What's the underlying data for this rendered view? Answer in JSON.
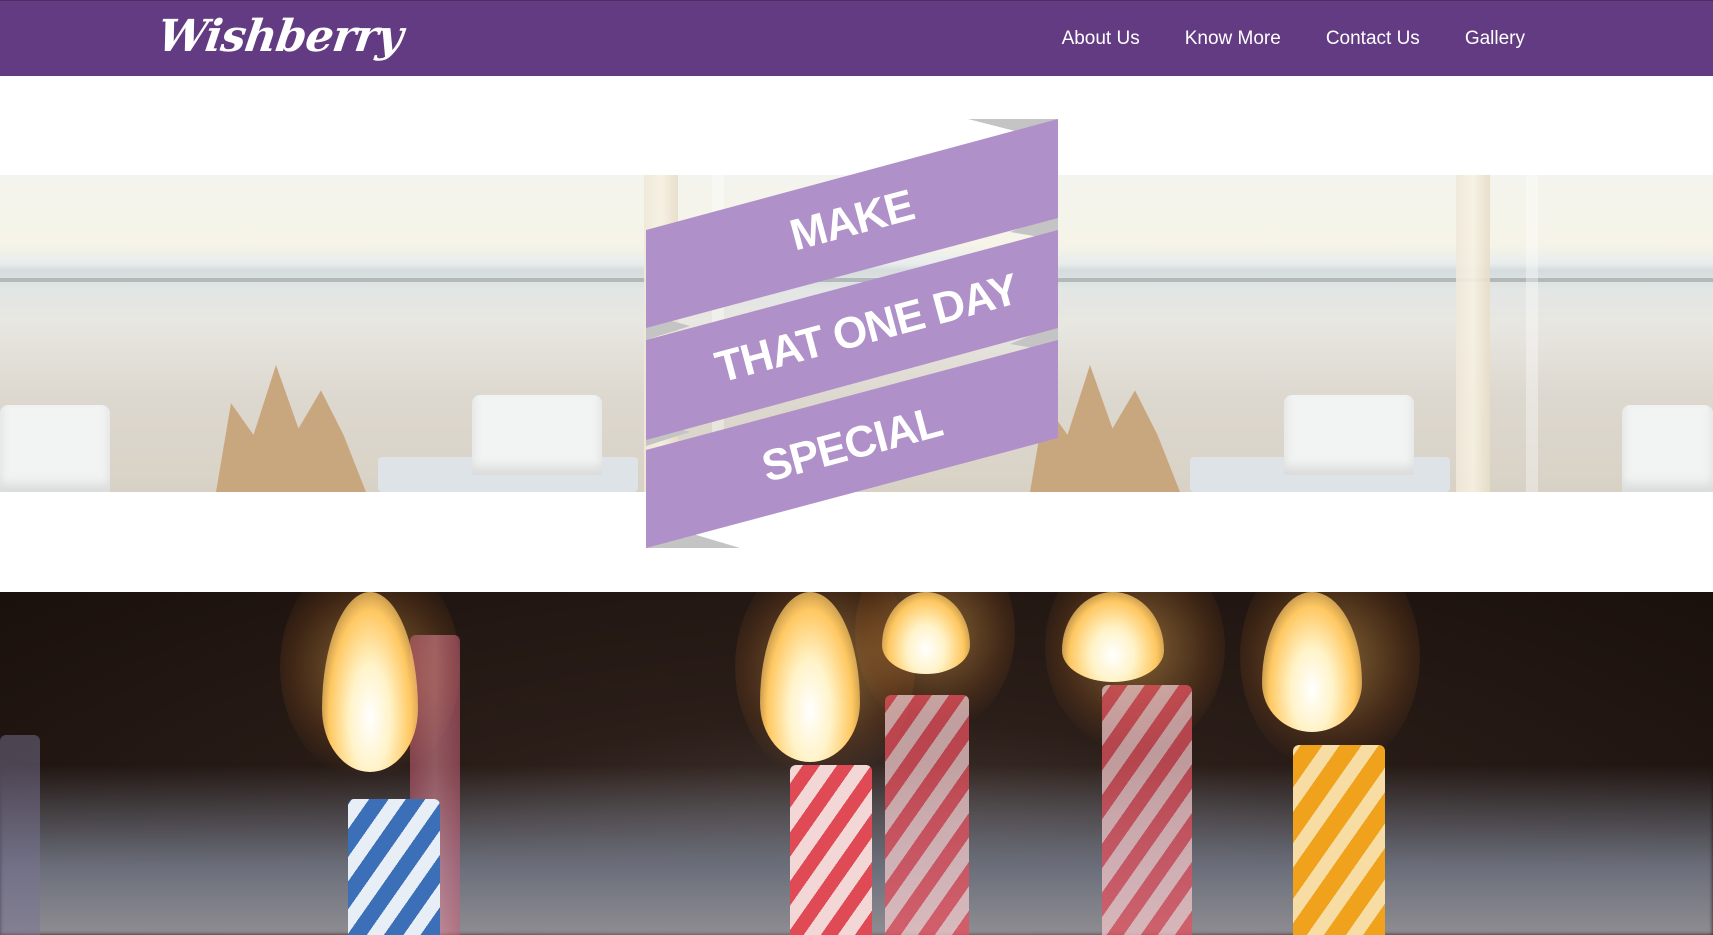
{
  "nav": {
    "brand": "Wishberry",
    "links": [
      "About Us",
      "Know More",
      "Contact Us",
      "Gallery"
    ]
  },
  "hero": {
    "ribbon_lines": [
      "MAKE",
      "THAT ONE DAY",
      "SPECIAL"
    ]
  },
  "colors": {
    "navbar": "#633b82",
    "ribbon": "#b090c8",
    "ribbon_fold": "#c4c4c4",
    "text_light": "#ffffff"
  },
  "images": {
    "beach_strip": "beach-party-cakes-photo",
    "candles_banner": "birthday-candles-photo"
  }
}
